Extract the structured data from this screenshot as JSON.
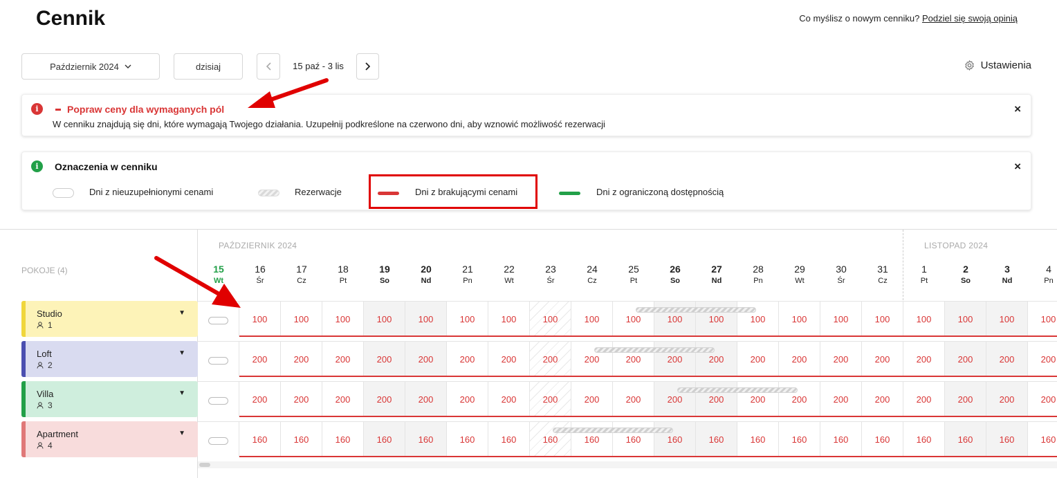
{
  "header": {
    "title": "Cennik",
    "feedback_prompt": "Co myślisz o nowym cenniku?",
    "feedback_link": "Podziel się swoją opinią"
  },
  "toolbar": {
    "month_select": "Październik 2024",
    "today_label": "dzisiaj",
    "range": "15 paź - 3 lis",
    "settings_label": "Ustawienia"
  },
  "alert": {
    "title": "Popraw ceny dla wymaganych pól",
    "text": "W cenniku znajdują się dni, które wymagają Twojego działania. Uzupełnij podkreślone na czerwono dni, aby wznowić możliwość rezerwacji",
    "close": "×"
  },
  "legend": {
    "title": "Oznaczenia w cenniku",
    "close": "×",
    "items": {
      "empty": "Dni z nieuzupełnionymi cenami",
      "reservations": "Rezerwacje",
      "missing": "Dni z brakującymi cenami",
      "limited": "Dni z ograniczoną dostępnością"
    }
  },
  "calendar": {
    "rooms_heading": "POKOJE (4)",
    "months": {
      "october": "PAŹDZIERNIK 2024",
      "november": "LISTOPAD 2024"
    },
    "days": [
      {
        "num": "15",
        "name": "Wt"
      },
      {
        "num": "16",
        "name": "Śr"
      },
      {
        "num": "17",
        "name": "Cz"
      },
      {
        "num": "18",
        "name": "Pt"
      },
      {
        "num": "19",
        "name": "So"
      },
      {
        "num": "20",
        "name": "Nd"
      },
      {
        "num": "21",
        "name": "Pn"
      },
      {
        "num": "22",
        "name": "Wt"
      },
      {
        "num": "23",
        "name": "Śr"
      },
      {
        "num": "24",
        "name": "Cz"
      },
      {
        "num": "25",
        "name": "Pt"
      },
      {
        "num": "26",
        "name": "So"
      },
      {
        "num": "27",
        "name": "Nd"
      },
      {
        "num": "28",
        "name": "Pn"
      },
      {
        "num": "29",
        "name": "Wt"
      },
      {
        "num": "30",
        "name": "Śr"
      },
      {
        "num": "31",
        "name": "Cz"
      },
      {
        "num": "1",
        "name": "Pt"
      },
      {
        "num": "2",
        "name": "So"
      },
      {
        "num": "3",
        "name": "Nd"
      },
      {
        "num": "4",
        "name": "Pn"
      }
    ],
    "rooms": [
      {
        "name": "Studio",
        "capacity": "1",
        "price": "100",
        "color": "#fdf3b8",
        "stripe": "#f0d63c"
      },
      {
        "name": "Loft",
        "capacity": "2",
        "price": "200",
        "color": "#d9dbf0",
        "stripe": "#4b4fb0"
      },
      {
        "name": "Villa",
        "capacity": "3",
        "price": "200",
        "color": "#cfeedd",
        "stripe": "#22a048"
      },
      {
        "name": "Apartment",
        "capacity": "4",
        "price": "160",
        "color": "#f8dcdc",
        "stripe": "#e07878"
      }
    ]
  },
  "colors": {
    "accent_red": "#d93636",
    "accent_green": "#22a048",
    "annotation_red": "#e00000"
  }
}
